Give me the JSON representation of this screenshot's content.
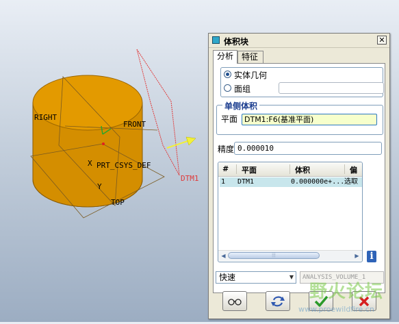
{
  "viewport": {
    "labels": {
      "right": "RIGHT",
      "front": "FRONT",
      "csys": "PRT_CSYS_DEF",
      "top": "TOP",
      "dtm1": "DTM1",
      "x": "X",
      "y": "Y"
    }
  },
  "dialog": {
    "title": "体积块",
    "close": "✕",
    "tabs": [
      "分析",
      "特征"
    ],
    "active_tab": "分析",
    "geometry": {
      "solid_label": "实体几何",
      "surface_label": "面组",
      "selected": "实体几何",
      "surface_value": ""
    },
    "one_side": {
      "title": "单侧体积",
      "plane_label": "平面",
      "plane_value": "DTM1:F6(基准平面)"
    },
    "precision": {
      "label": "精度",
      "value": "0.000010"
    },
    "table": {
      "headers": [
        "#",
        "平面",
        "体积",
        "偏"
      ],
      "rows": [
        [
          "1",
          "DTM1",
          "0.000000e+...",
          "选取"
        ]
      ]
    },
    "info_icon": "i",
    "mode": "快速",
    "analysis_name": "ANALYSIS_VOLUME_1"
  },
  "watermark": {
    "text": "野火论坛",
    "url": "www.proewildfire.cn"
  },
  "colors": {
    "solid_fill": "#d99400",
    "datum_red": "#e03a3a",
    "highlight_row": "#c8e6ec",
    "plane_field": "#f6ffcc"
  }
}
